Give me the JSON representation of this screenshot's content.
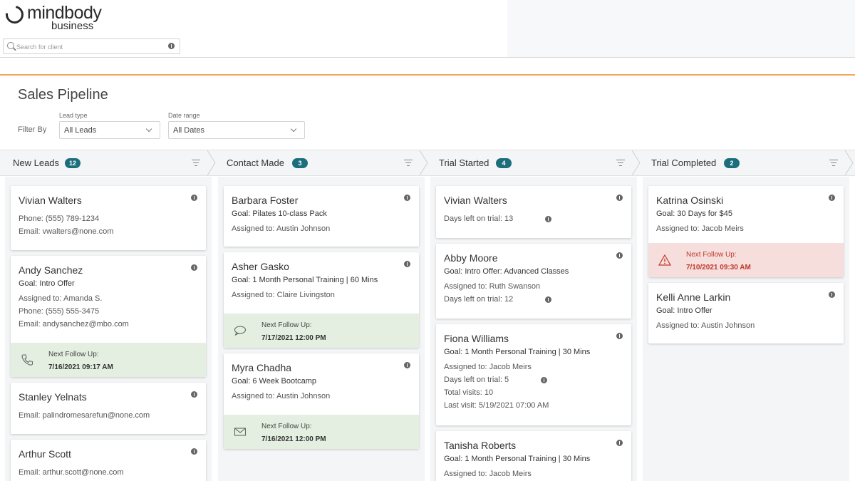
{
  "header": {
    "brand": "mindbody",
    "brand_sub": "business",
    "search_placeholder": "Search for client"
  },
  "page": {
    "title": "Sales Pipeline",
    "filter_by_label": "Filter By",
    "lead_type_label": "Lead type",
    "lead_type_value": "All Leads",
    "date_range_label": "Date range",
    "date_range_value": "All Dates"
  },
  "colors": {
    "accent_orange": "#f5a45d",
    "badge_teal": "#1c6e7d",
    "follow_green": "#e4efe1",
    "follow_red": "#f6dedd"
  },
  "stages": [
    {
      "name": "New Leads",
      "count": "12",
      "cards": [
        {
          "name": "Vivian Walters",
          "lines": [
            "Phone: (555) 789-1234",
            "Email: vwalters@none.com"
          ]
        },
        {
          "name": "Andy Sanchez",
          "goal": "Goal: Intro Offer",
          "lines": [
            "Assigned to: Amanda S.",
            "Phone: (555) 555-3475",
            "Email: andysanchez@mbo.com"
          ],
          "follow": {
            "title": "Next Follow Up:",
            "date": "7/16/2021 09:17 AM",
            "icon": "phone-icon"
          }
        },
        {
          "name": "Stanley Yelnats",
          "lines": [
            "Email: palindromesarefun@none.com"
          ]
        },
        {
          "name": "Arthur Scott",
          "lines": [
            "Email: arthur.scott@none.com"
          ]
        }
      ]
    },
    {
      "name": "Contact Made",
      "count": "3",
      "cards": [
        {
          "name": "Barbara Foster",
          "goal": "Goal: Pilates 10-class Pack",
          "lines": [
            "Assigned to: Austin Johnson"
          ]
        },
        {
          "name": "Asher Gasko",
          "goal": "Goal: 1 Month Personal Training | 60 Mins",
          "lines": [
            "Assigned to: Claire Livingston"
          ],
          "follow": {
            "title": "Next Follow Up:",
            "date": "7/17/2021 12:00 PM",
            "icon": "chat-icon"
          }
        },
        {
          "name": "Myra Chadha",
          "goal": "Goal: 6 Week Bootcamp",
          "lines": [
            "Assigned to: Austin Johnson"
          ],
          "follow": {
            "title": "Next Follow Up:",
            "date": "7/16/2021 12:00 PM",
            "icon": "mail-icon"
          }
        }
      ]
    },
    {
      "name": "Trial Started",
      "count": "4",
      "cards": [
        {
          "name": "Vivian Walters",
          "lines": [
            "Days left on trial: 13"
          ]
        },
        {
          "name": "Abby Moore",
          "goal": "Goal: Intro Offer: Advanced Classes",
          "lines": [
            "Assigned to: Ruth Swanson",
            "Days left on trial: 12"
          ]
        },
        {
          "name": "Fiona Williams",
          "goal": "Goal: 1 Month Personal Training | 30 Mins",
          "lines": [
            "Assigned to: Jacob Meirs",
            "Days left on trial: 5",
            "Total visits: 10",
            "Last visit: 5/19/2021 07:00 AM"
          ]
        },
        {
          "name": "Tanisha Roberts",
          "goal": "Goal: 1 Month Personal Training | 30 Mins",
          "lines": [
            "Assigned to: Jacob Meirs"
          ]
        }
      ]
    },
    {
      "name": "Trial Completed",
      "count": "2",
      "cards": [
        {
          "name": "Katrina Osinski",
          "goal": "Goal: 30 Days for $45",
          "lines": [
            "Assigned to: Jacob Meirs"
          ],
          "follow": {
            "title": "Next Follow Up:",
            "date": "7/10/2021 09:30 AM",
            "icon": "warning-icon"
          }
        },
        {
          "name": "Kelli Anne Larkin",
          "goal": "Goal: Intro Offer",
          "lines": [
            "Assigned to: Austin Johnson"
          ]
        }
      ]
    }
  ]
}
